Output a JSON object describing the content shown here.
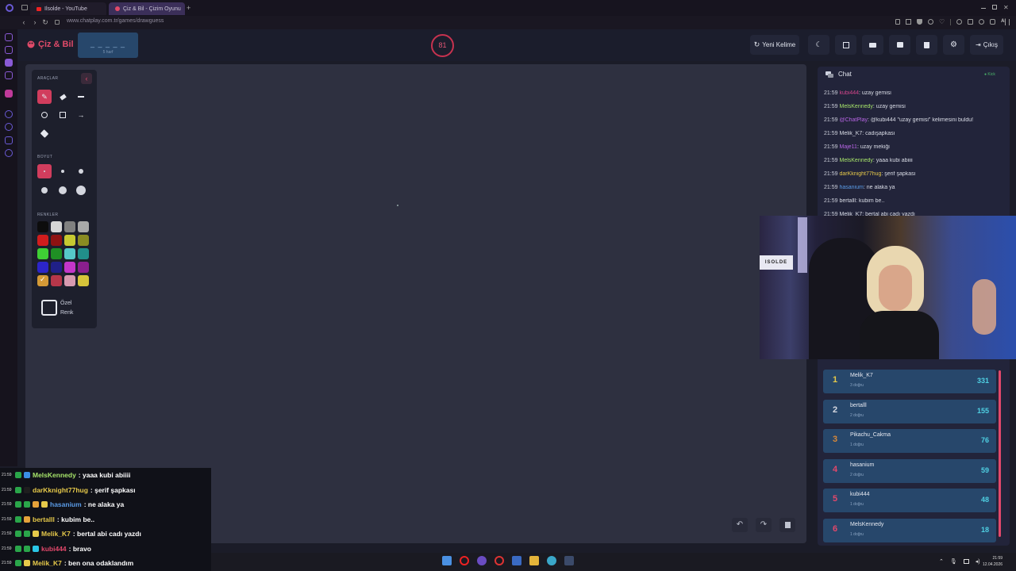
{
  "browser": {
    "tabs": [
      {
        "label": "Ilsolde - YouTube"
      },
      {
        "label": "Çiz & Bil - Çizim Oyunu"
      }
    ],
    "new_tab_glyph": "+",
    "url": "www.chatplay.com.tr/games/drawguess",
    "ai_label": "AI"
  },
  "app": {
    "brand": "Çiz & Bil",
    "word_mask": "_ _ _ _ _",
    "word_hint": "5 harf",
    "timer": "81",
    "new_word_label": "Yeni Kelime",
    "exit_label": "Çıkış"
  },
  "tools": {
    "tools_title": "ARAÇLAR",
    "size_title": "BOYUT",
    "colors_title": "RENKLER",
    "custom_color_line1": "Özel",
    "custom_color_line2": "Renk",
    "palette": [
      "#0d0d0d",
      "#d6d6d6",
      "#808080",
      "#a9a9a9",
      "#d01d1d",
      "#8e1212",
      "#c6c931",
      "#8a8b22",
      "#3fcf35",
      "#1f8f24",
      "#56c9c9",
      "#218f8a",
      "#2c25c9",
      "#202087",
      "#c436c9",
      "#8a1f8e",
      "#d49a37",
      "#b7374a",
      "#d79ab0",
      "#d6c43a"
    ]
  },
  "chat": {
    "title": "Chat",
    "kick": "Kick",
    "messages": [
      {
        "time": "21:59",
        "user": "kubi444",
        "color": "#d0458a",
        "text": ": uzay gemisi"
      },
      {
        "time": "21:59",
        "user": "MelsKennedy",
        "color": "#a6e36a",
        "text": ": uzay gemisi"
      },
      {
        "time": "21:59",
        "user": "@ChatPlay",
        "color": "#b865e6",
        "text": ": @kubi444 \"uzay gemisi\" kelimesini buldu!"
      },
      {
        "time": "21:59",
        "user": "Melik_K7",
        "color": "#d9dce6",
        "text": ": cadışapkası"
      },
      {
        "time": "21:59",
        "user": "Maje11",
        "color": "#b865e6",
        "text": ": uzay mekiği"
      },
      {
        "time": "21:59",
        "user": "MelsKennedy",
        "color": "#a6e36a",
        "text": ": yaaa kubi abiiii"
      },
      {
        "time": "21:59",
        "user": "darKknight77hug",
        "color": "#e6c94a",
        "text": ": şerif şapkası"
      },
      {
        "time": "21:59",
        "user": "hasanium",
        "color": "#5a9be6",
        "text": ": ne alaka ya"
      },
      {
        "time": "21:59",
        "user": "bertalll",
        "color": "#d9dce6",
        "text": ": kubim be.."
      },
      {
        "time": "21:59",
        "user": "Melik_K7",
        "color": "#d9dce6",
        "text": ": bertal abi cadı yazdı"
      }
    ]
  },
  "leaderboard": [
    {
      "rank": "1",
      "name": "Melik_K7",
      "sub": "3 doğru",
      "score": "331",
      "rank_color": "#e6c94a"
    },
    {
      "rank": "2",
      "name": "bertalll",
      "sub": "2 doğru",
      "score": "155",
      "rank_color": "#d6d8e0"
    },
    {
      "rank": "3",
      "name": "Pikachu_Cakma",
      "sub": "1 doğru",
      "score": "76",
      "rank_color": "#d6883a"
    },
    {
      "rank": "4",
      "name": "hasanium",
      "sub": "2 doğru",
      "score": "59",
      "rank_color": "#e2486b"
    },
    {
      "rank": "5",
      "name": "kubi444",
      "sub": "1 doğru",
      "score": "48",
      "rank_color": "#e2486b"
    },
    {
      "rank": "6",
      "name": "MelsKennedy",
      "sub": "1 doğru",
      "score": "18",
      "rank_color": "#e2486b"
    }
  ],
  "webcam": {
    "sign_text": "ISOLDE"
  },
  "overlay_chat": [
    {
      "time": "21:59",
      "user": "MelsKennedy",
      "color": "#a6e36a",
      "text": " : yaaa kubi abiiii"
    },
    {
      "time": "21:59",
      "user": "darKknight77hug",
      "color": "#e6c94a",
      "text": " : şerif şapkası"
    },
    {
      "time": "21:59",
      "user": "hasanium",
      "color": "#5a9be6",
      "text": " : ne alaka ya"
    },
    {
      "time": "21:59",
      "user": "bertalll",
      "color": "#e6c94a",
      "text": " : kubim be.."
    },
    {
      "time": "21:59",
      "user": "Melik_K7",
      "color": "#e6c94a",
      "text": " : bertal abi cadı yazdı"
    },
    {
      "time": "21:59",
      "user": "kubi444",
      "color": "#e2486b",
      "text": " : bravo"
    },
    {
      "time": "21:59",
      "user": "Melik_K7",
      "color": "#e6c94a",
      "text": " : ben ona odaklandım"
    }
  ],
  "taskbar": {
    "time": "21:59",
    "date": "12.04.2026"
  }
}
